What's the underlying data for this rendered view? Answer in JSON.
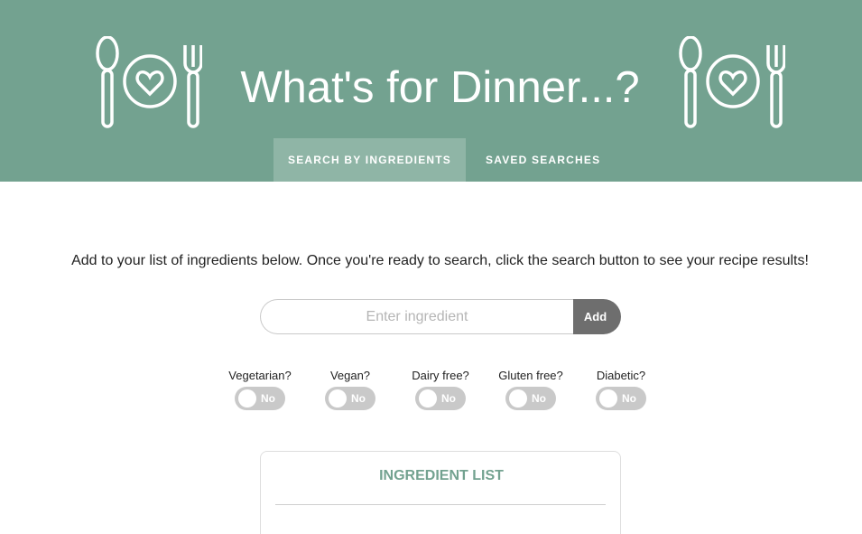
{
  "header": {
    "title": "What's for Dinner...?",
    "icons": [
      "spoon-icon",
      "heart-plate-icon",
      "fork-icon"
    ],
    "background_color": "#73a290"
  },
  "tabs": [
    {
      "label": "Search by Ingredients",
      "active": true
    },
    {
      "label": "Saved Searches",
      "active": false
    }
  ],
  "instructions": "Add to your list of ingredients below. Once you're ready to search, click the search button to see your recipe results!",
  "search": {
    "placeholder": "Enter ingredient",
    "value": "",
    "add_label": "Add"
  },
  "filters": [
    {
      "label": "Vegetarian?",
      "state": "No"
    },
    {
      "label": "Vegan?",
      "state": "No"
    },
    {
      "label": "Dairy free?",
      "state": "No"
    },
    {
      "label": "Gluten free?",
      "state": "No"
    },
    {
      "label": "Diabetic?",
      "state": "No"
    }
  ],
  "ingredient_list": {
    "title": "INGREDIENT LIST",
    "items": []
  }
}
